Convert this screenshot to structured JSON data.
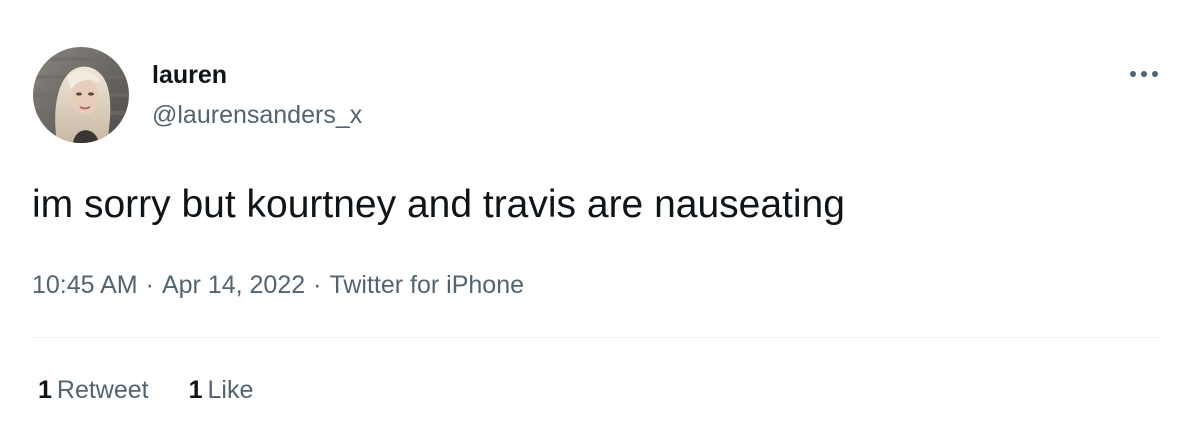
{
  "author": {
    "display_name": "lauren",
    "handle": "@laurensanders_x",
    "avatar_icon": "profile-photo"
  },
  "more_icon": "more-horizontal-icon",
  "tweet": {
    "text": "im sorry but kourtney and travis are nauseating",
    "time": "10:45 AM",
    "separator": "·",
    "date": "Apr 14, 2022",
    "source": "Twitter for iPhone"
  },
  "stats": {
    "retweets": {
      "count": "1",
      "label": "Retweet"
    },
    "likes": {
      "count": "1",
      "label": "Like"
    }
  },
  "colors": {
    "text_primary": "#0f1419",
    "text_secondary": "#536471",
    "divider": "#eff3f4",
    "background": "#ffffff"
  }
}
